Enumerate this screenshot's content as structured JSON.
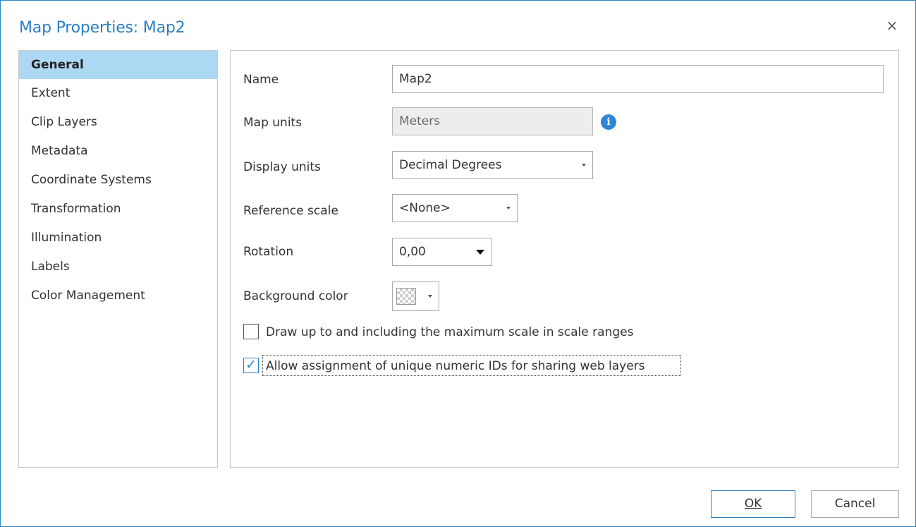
{
  "window": {
    "title": "Map Properties: Map2",
    "close_glyph": "×"
  },
  "sidebar": {
    "items": [
      {
        "label": "General",
        "active": true
      },
      {
        "label": "Extent"
      },
      {
        "label": "Clip Layers"
      },
      {
        "label": "Metadata"
      },
      {
        "label": "Coordinate Systems"
      },
      {
        "label": "Transformation"
      },
      {
        "label": "Illumination"
      },
      {
        "label": "Labels"
      },
      {
        "label": "Color Management"
      }
    ]
  },
  "general": {
    "name": {
      "label": "Name",
      "value": "Map2"
    },
    "map_units": {
      "label": "Map units",
      "value": "Meters",
      "info_icon": "info-icon"
    },
    "display_units": {
      "label": "Display units",
      "value": "Decimal Degrees"
    },
    "reference_scale": {
      "label": "Reference scale",
      "value": "<None>"
    },
    "rotation": {
      "label": "Rotation",
      "value": "0,00"
    },
    "background_color": {
      "label": "Background color",
      "value_icon": "transparent-swatch"
    },
    "draw_max_scale": {
      "label": "Draw up to and including the maximum scale in scale ranges",
      "checked": false
    },
    "unique_ids": {
      "label": "Allow assignment of unique numeric IDs for sharing web layers",
      "checked": true
    }
  },
  "buttons": {
    "ok": "OK",
    "cancel": "Cancel"
  },
  "colors": {
    "accent": "#2b7fc1",
    "selection": "#add8f4"
  }
}
